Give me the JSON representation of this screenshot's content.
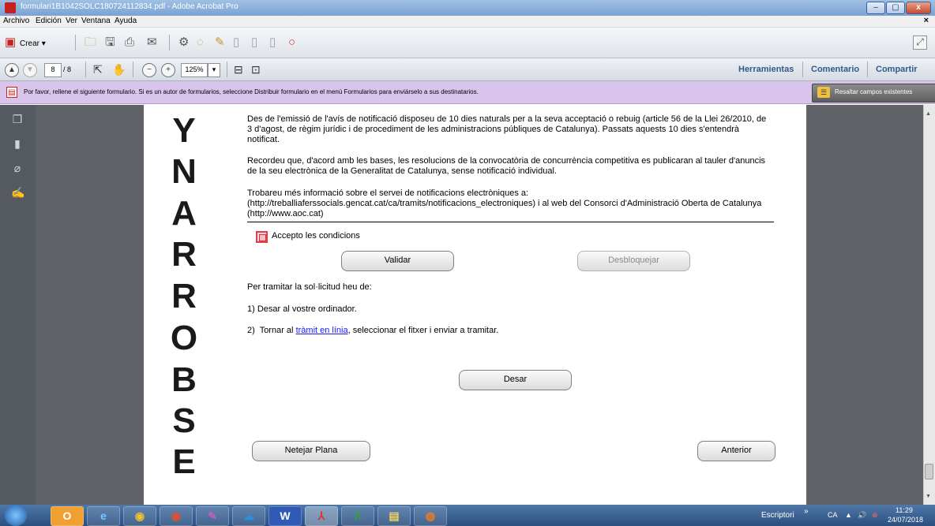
{
  "window": {
    "title": "formulari1B1042SOLC180724112834.pdf - Adobe Acrobat Pro",
    "btn_min": "–",
    "btn_max": "▢",
    "btn_close": "x"
  },
  "menu": {
    "items": [
      "Archivo",
      "Edición",
      "Ver",
      "Ventana",
      "Ayuda"
    ],
    "close": "×"
  },
  "toolbar": {
    "create_label": "Crear ▾",
    "current_page": "8",
    "total_pages": "/ 8",
    "zoom": "125%",
    "zoom_dropdown": "▾",
    "links": [
      "Herramientas",
      "Comentario",
      "Compartir"
    ]
  },
  "infobar": {
    "message": "Por favor, rellene el siguiente formulario. Si es un autor de formularios, seleccione Distribuir formulario en el menú Formularios para enviárselo a sus destinatarios.",
    "highlight_button": "Resaltar campos existentes"
  },
  "document": {
    "watermark_letters": [
      "Y",
      "N",
      "A",
      "R",
      "R",
      "O",
      "B",
      "S",
      "E"
    ],
    "paragraphs": [
      "Des de l'emissió de l'avís de notificació disposeu de 10 dies naturals per a la seva acceptació o rebuig (article 56 de la Llei 26/2010, de 3 d'agost, de règim jurídic i de procediment de les administracions públiques de Catalunya). Passats aquests 10 dies s'entendrà notificat.",
      "Recordeu que, d'acord amb les bases, les resolucions de la convocatòria de concurrència competitiva es publicaran al tauler d'anuncis de la seu electrònica de la Generalitat de Catalunya, sense notificació individual.",
      "Trobareu més informació sobre el servei de notificacions electròniques a: (http://treballiaferssocials.gencat.cat/ca/tramits/notificacions_electroniques) i al web del Consorci d'Administració Oberta de Catalunya (http://www.aoc.cat)"
    ],
    "checkbox_label": "Accepto les condicions",
    "validate_button": "Validar",
    "unlock_button": "Desbloquejar",
    "instructions_title": "Per tramitar la sol·licitud heu de:",
    "step1": "1)  Desar al vostre ordinador.",
    "step2_prefix": "2)  Tornar al ",
    "step2_link": "tràmit en línia",
    "step2_suffix": ", seleccionar el fitxer i enviar a tramitar.",
    "save_button": "Desar",
    "clear_button": "Netejar Plana",
    "previous_button": "Anterior"
  },
  "taskbar": {
    "apps": [
      "O",
      "e",
      "◉",
      "◉",
      "✎",
      "☁",
      "W",
      "⅄",
      "X",
      "▤",
      "◍"
    ],
    "desktop_label": "Escriptori",
    "chevron": "»",
    "lang": "CA",
    "time": "11:29",
    "date": "24/07/2018"
  },
  "colors": {
    "infobar": "#d9c5ec",
    "link": "#2d5a8f",
    "checkbox_border": "#e0404a"
  }
}
